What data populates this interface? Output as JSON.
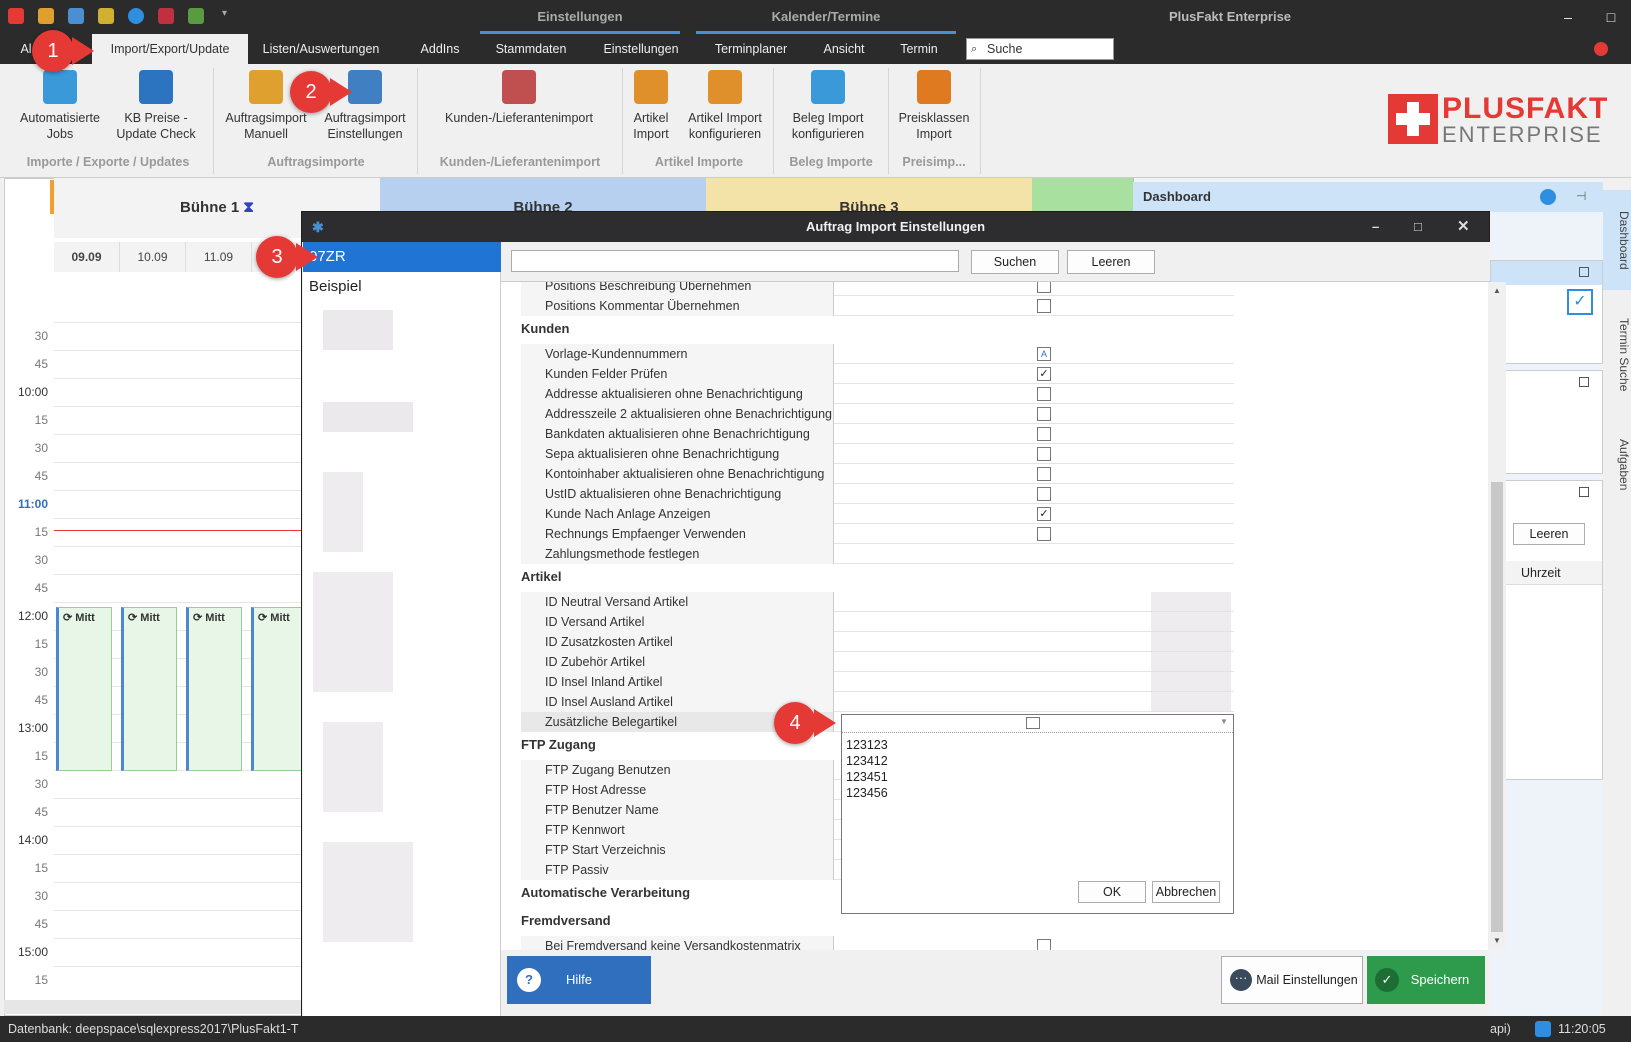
{
  "window": {
    "context_tab": "Einstellungen",
    "context_tab2": "Kalender/Termine",
    "title": "PlusFakt Enterprise"
  },
  "menu": {
    "items": [
      "Al",
      "Import/Export/Update",
      "Listen/Auswertungen",
      "AddIns",
      "Stammdaten",
      "Einstellungen",
      "Terminplaner",
      "Ansicht",
      "Termin"
    ],
    "search_placeholder": "Suche"
  },
  "ribbon": {
    "buttons": [
      {
        "label1": "Automatisierte",
        "label2": "Jobs",
        "color": "#3a9ad9"
      },
      {
        "label1": "KB Preise -",
        "label2": "Update Check",
        "color": "#2c73c0"
      },
      {
        "label1": "Auftragsimport",
        "label2": "Manuell",
        "color": "#e0a030"
      },
      {
        "label1": "Auftragsimport",
        "label2": "Einstellungen",
        "color": "#3f7fc2"
      },
      {
        "label1": "Kunden-/Lieferantenimport",
        "label2": "",
        "color": "#c05050"
      },
      {
        "label1": "Artikel",
        "label2": "Import",
        "color": "#e0902a"
      },
      {
        "label1": "Artikel Import",
        "label2": "konfigurieren",
        "color": "#e0902a"
      },
      {
        "label1": "Beleg Import",
        "label2": "konfigurieren",
        "color": "#3a9ad9"
      },
      {
        "label1": "Preisklassen",
        "label2": "Import",
        "color": "#e07a20"
      }
    ],
    "groups": [
      "Importe / Exporte / Updates",
      "Auftragsimporte",
      "Kunden-/Lieferantenimport",
      "Artikel Importe",
      "Beleg Importe",
      "Preisimp..."
    ]
  },
  "logo": {
    "line1": "PLUSFAKT",
    "line2": "ENTERPRISE"
  },
  "calendar": {
    "stages": [
      "Bühne 1",
      "Bühne 2",
      "Bühne 3"
    ],
    "days": [
      "09.09",
      "10.09",
      "11.09"
    ],
    "times": [
      "30",
      "45",
      "10:00",
      "15",
      "30",
      "45",
      "11:00",
      "15",
      "30",
      "45",
      "12:00",
      "15",
      "30",
      "45",
      "13:00",
      "15",
      "30",
      "45",
      "14:00",
      "15",
      "30",
      "45",
      "15:00",
      "15"
    ],
    "appointment": "Mitt"
  },
  "dashboard": {
    "title": "Dashboard",
    "clear_button": "Leeren",
    "time_header": "Uhrzeit"
  },
  "side_tabs": [
    "Dashboard",
    "Termin Suche",
    "Aufgaben"
  ],
  "dialog": {
    "title": "Auftrag Import Einstellungen",
    "list": [
      "07ZR",
      "Beispiel"
    ],
    "search_button": "Suchen",
    "clear_button": "Leeren",
    "rows_top": [
      "Positions Beschreibung Übernehmen",
      "Positions Kommentar Übernehmen"
    ],
    "sections": {
      "kunden": {
        "title": "Kunden",
        "rows": [
          {
            "label": "Vorlage-Kundennummern",
            "check": "edit"
          },
          {
            "label": "Kunden Felder Prüfen",
            "check": "✓"
          },
          {
            "label": "Addresse aktualisieren ohne Benachrichtigung",
            "check": ""
          },
          {
            "label": "Addresszeile 2 aktualisieren ohne Benachrichtigung",
            "check": ""
          },
          {
            "label": "Bankdaten aktualisieren ohne Benachrichtigung",
            "check": ""
          },
          {
            "label": "Sepa aktualisieren ohne Benachrichtigung",
            "check": ""
          },
          {
            "label": "Kontoinhaber aktualisieren ohne Benachrichtigung",
            "check": ""
          },
          {
            "label": "UstID aktualisieren ohne Benachrichtigung",
            "check": ""
          },
          {
            "label": "Kunde Nach Anlage Anzeigen",
            "check": "✓"
          },
          {
            "label": "Rechnungs Empfaenger Verwenden",
            "check": ""
          },
          {
            "label": "Zahlungsmethode festlegen",
            "check": "none"
          }
        ]
      },
      "artikel": {
        "title": "Artikel",
        "rows": [
          "ID Neutral Versand Artikel",
          "ID Versand Artikel",
          "ID Zusatzkosten Artikel",
          "ID Zubehör Artikel",
          "ID Insel Inland Artikel",
          "ID Insel Ausland Artikel",
          "Zusätzliche Belegartikel"
        ]
      },
      "ftp": {
        "title": "FTP Zugang",
        "rows": [
          "FTP Zugang Benutzen",
          "FTP Host Adresse",
          "FTP Benutzer Name",
          "FTP Kennwort",
          "FTP Start Verzeichnis",
          "FTP Passiv"
        ]
      },
      "auto": {
        "title": "Automatische Verarbeitung"
      },
      "fremd": {
        "title": "Fremdversand",
        "rows": [
          "Bei Fremdversand keine Versandkostenmatrix"
        ]
      }
    },
    "popup": {
      "lines": [
        "123123",
        "123412",
        "123451",
        "123456"
      ],
      "ok": "OK",
      "cancel": "Abbrechen"
    },
    "buttons": {
      "help": "Hilfe",
      "mail": "Mail Einstellungen",
      "save": "Speichern"
    }
  },
  "status": {
    "db": "Datenbank: deepspace\\sqlexpress2017\\PlusFakt1-T",
    "partial": "api)",
    "time": "11:20:05"
  },
  "badges": [
    "1",
    "2",
    "3",
    "4"
  ]
}
